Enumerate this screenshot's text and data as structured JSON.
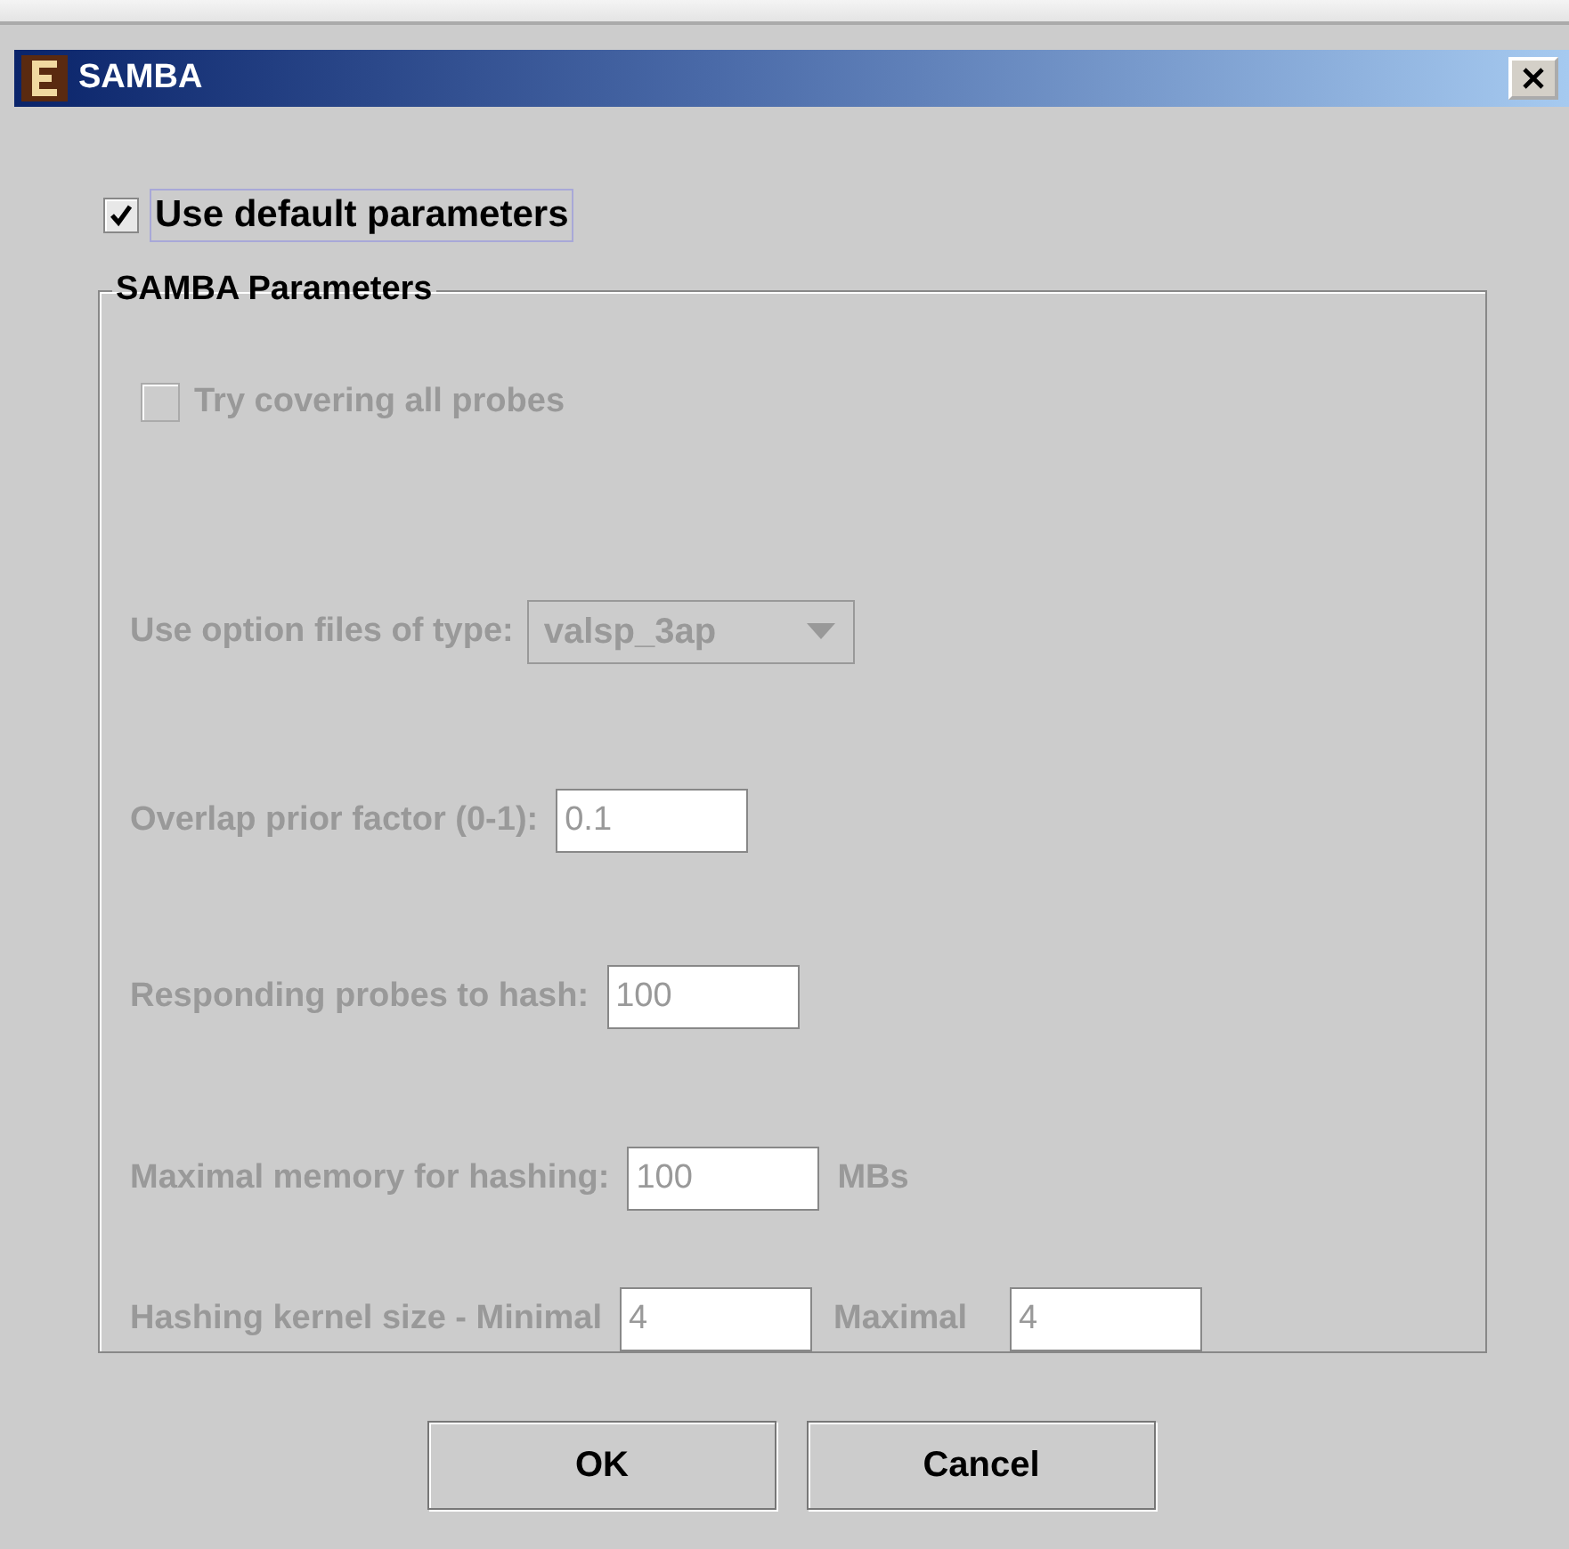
{
  "window": {
    "title": "SAMBA"
  },
  "use_default": {
    "label": "Use default parameters",
    "checked": true
  },
  "group": {
    "title": "SAMBA Parameters",
    "disabled": true,
    "rows": [
      {
        "kind": "checkbox",
        "label": "Try covering all probes",
        "checked": false
      },
      {
        "kind": "select",
        "label": "Use option files of type:",
        "value": "valsp_3ap"
      },
      {
        "kind": "input",
        "label": "Overlap prior factor (0-1):",
        "value": "0.1"
      },
      {
        "kind": "input",
        "label": "Responding probes to hash:",
        "value": "100"
      },
      {
        "kind": "input",
        "label": "Maximal memory for hashing:",
        "value": "100",
        "unit": "MBs"
      },
      {
        "kind": "range",
        "label": "Hashing kernel size - Minimal",
        "value": "4",
        "label2": "Maximal",
        "value2": "4"
      }
    ]
  },
  "buttons": [
    "OK",
    "Cancel"
  ]
}
